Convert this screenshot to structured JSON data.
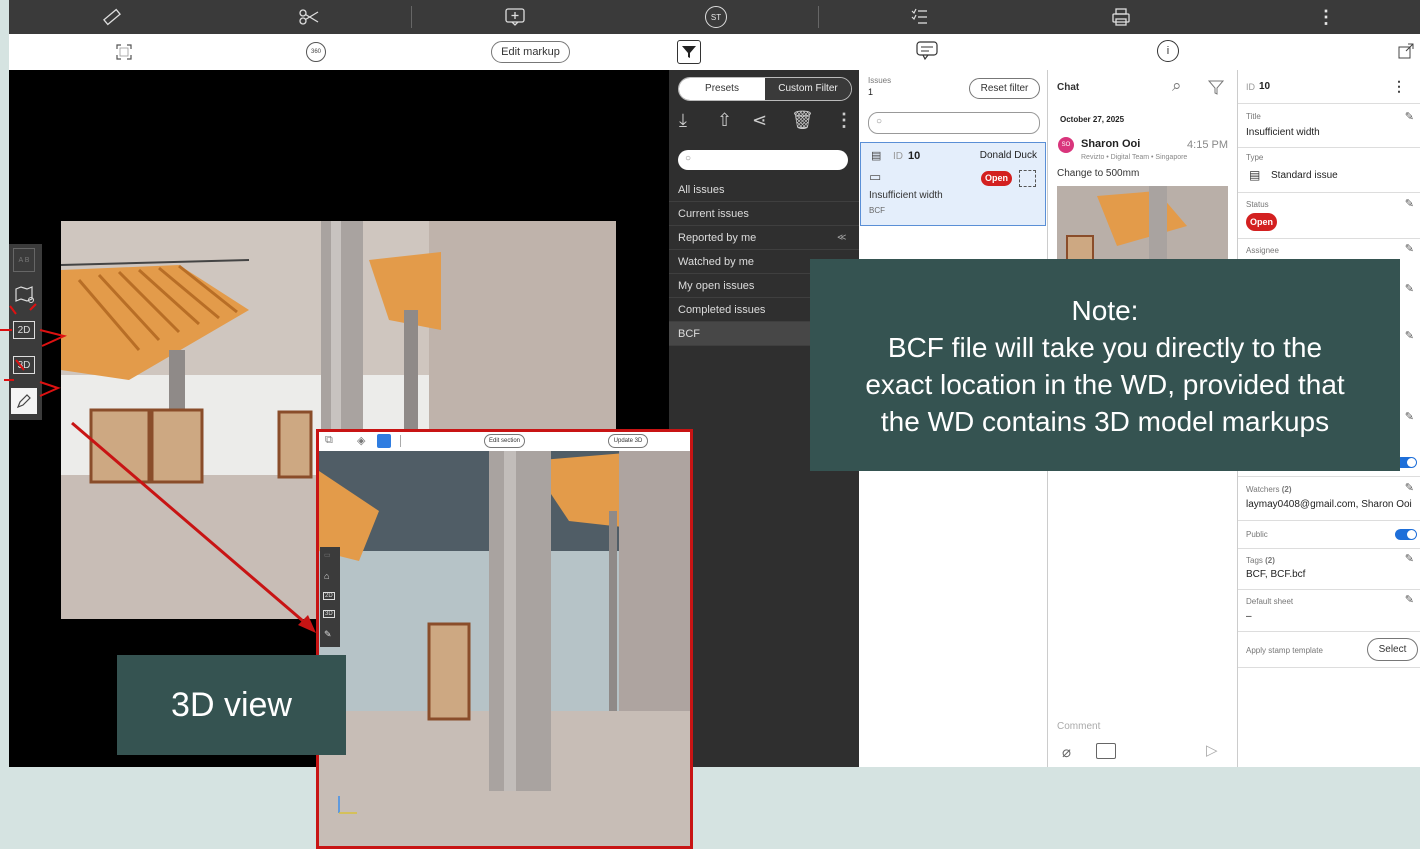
{
  "toolbar": {
    "icons": [
      "ruler-icon",
      "scissors-icon",
      "add-markup-icon",
      "stamp-icon",
      "checklist-icon",
      "print-icon",
      "more-vert-icon"
    ],
    "stamp_label": "ST"
  },
  "viewer_bar": {
    "zoom_label": "360",
    "edit_markup": "Edit markup"
  },
  "side_toolbar": {
    "btn_2d": "2D",
    "btn_3d": "3D",
    "sheet_label": "A B"
  },
  "filters": {
    "presets_tab": "Presets",
    "custom_tab": "Custom Filter",
    "items": [
      "All issues",
      "Current issues",
      "Reported by me",
      "Watched by me",
      "My open issues",
      "Completed issues",
      "BCF"
    ]
  },
  "issues": {
    "label": "Issues",
    "count": "1",
    "reset": "Reset filter",
    "card": {
      "id_label": "ID",
      "id": "10",
      "assignee": "Donald Duck",
      "status": "Open",
      "title": "Insufficient width",
      "tag": "BCF"
    }
  },
  "chat": {
    "title": "Chat",
    "date": "October 27, 2025",
    "author_initials": "SO",
    "author": "Sharon Ooi",
    "time": "4:15 PM",
    "org": "Revizto • Digital Team • Singapore",
    "message": "Change to 500mm",
    "comment_placeholder": "Comment"
  },
  "details": {
    "id_label": "ID",
    "id": "10",
    "title_label": "Title",
    "title": "Insufficient width",
    "type_label": "Type",
    "type": "Standard issue",
    "status_label": "Status",
    "status": "Open",
    "assignee_label": "Assignee",
    "watchers_label": "Watchers",
    "watchers_count": "(2)",
    "watchers": "laymay0408@gmail.com, Sharon Ooi",
    "public_label": "Public",
    "tags_label": "Tags",
    "tags_count": "(2)",
    "tags": "BCF, BCF.bcf",
    "default_sheet_label": "Default sheet",
    "default_sheet": "–",
    "stamp_label": "Apply stamp template",
    "select": "Select"
  },
  "inset": {
    "edit_section": "Edit section",
    "update_3d": "Update 3D",
    "btn_2d": "2D",
    "btn_3d": "3D"
  },
  "note": {
    "heading": "Note:",
    "line1": "BCF file will take you directly to the",
    "line2": "exact location in the WD, provided that",
    "line3": "the WD contains 3D model markups"
  },
  "label_3d": "3D view",
  "colors": {
    "accent_red": "#c81414",
    "status_red": "#d32020",
    "callout": "#355351",
    "toggle_blue": "#1e6fd9",
    "issue_card": "#e4eefb"
  }
}
